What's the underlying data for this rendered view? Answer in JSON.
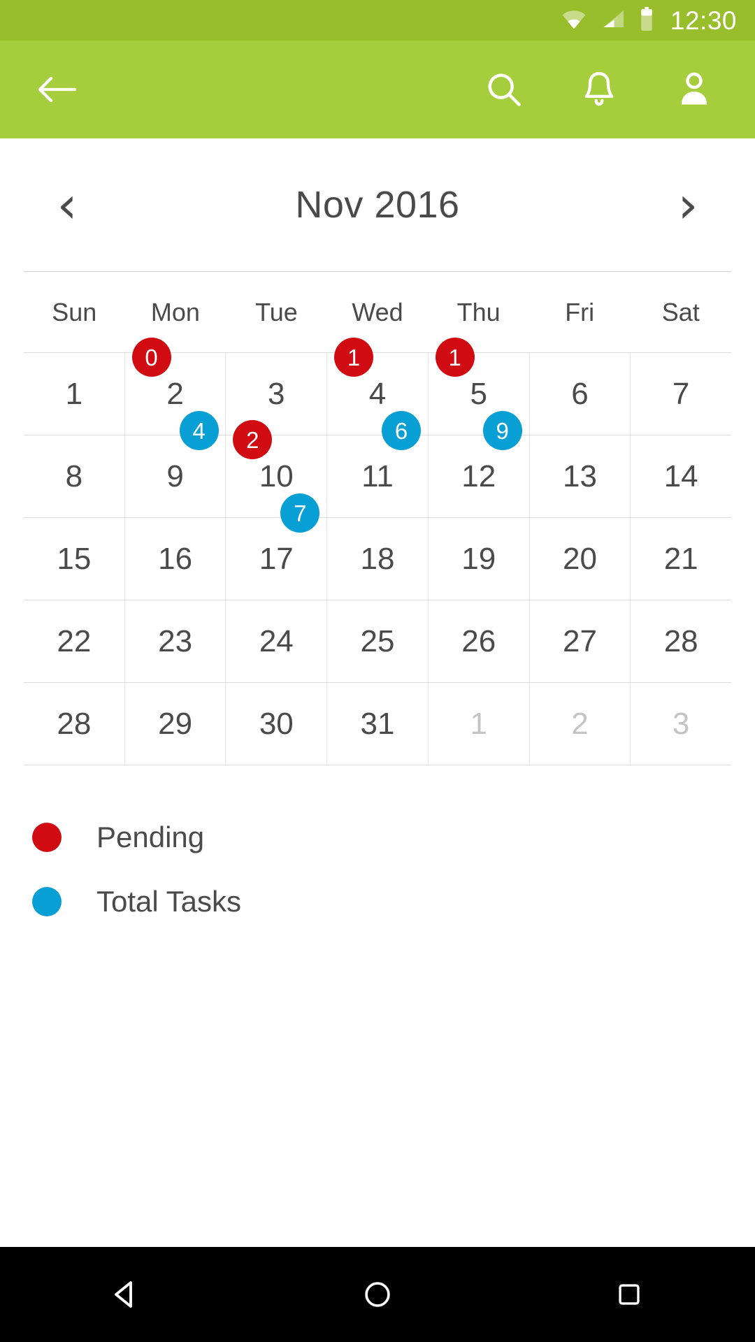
{
  "status_bar": {
    "time": "12:30",
    "icons": [
      "wifi-icon",
      "signal-icon",
      "battery-icon"
    ],
    "background": "#99be2c"
  },
  "app_bar": {
    "background": "#a6ce3c",
    "back_icon": "arrow-back-icon",
    "actions": [
      {
        "icon": "search-icon",
        "label": "Search"
      },
      {
        "icon": "bell-icon",
        "label": "Notifications"
      },
      {
        "icon": "person-icon",
        "label": "Profile"
      }
    ]
  },
  "month_header": {
    "prev_label": "‹",
    "next_label": "›",
    "title": "Nov 2016"
  },
  "weekdays": [
    "Sun",
    "Mon",
    "Tue",
    "Wed",
    "Thu",
    "Fri",
    "Sat"
  ],
  "legend": {
    "items": [
      {
        "label": "Pending",
        "color": "#d00b11"
      },
      {
        "label": "Total Tasks",
        "color": "#08a0d4"
      }
    ]
  },
  "nav_bar": {
    "back": "back-triangle-icon",
    "home": "home-circle-icon",
    "recents": "recents-square-icon"
  },
  "chart_data": {
    "type": "table",
    "title": "Nov 2016",
    "legend": [
      "Pending",
      "Total Tasks"
    ],
    "colors": {
      "pending": "#d00b11",
      "total": "#08a0d4"
    },
    "weeks": [
      [
        {
          "day": "1",
          "muted": false,
          "pending": null,
          "total": null
        },
        {
          "day": "2",
          "muted": false,
          "pending": "0",
          "total": "4"
        },
        {
          "day": "3",
          "muted": false,
          "pending": null,
          "total": null
        },
        {
          "day": "4",
          "muted": false,
          "pending": "1",
          "total": "6"
        },
        {
          "day": "5",
          "muted": false,
          "pending": "1",
          "total": "9"
        },
        {
          "day": "6",
          "muted": false,
          "pending": null,
          "total": null
        },
        {
          "day": "7",
          "muted": false,
          "pending": null,
          "total": null
        }
      ],
      [
        {
          "day": "8",
          "muted": false,
          "pending": null,
          "total": null
        },
        {
          "day": "9",
          "muted": false,
          "pending": null,
          "total": null
        },
        {
          "day": "10",
          "muted": false,
          "pending": "2",
          "total": "7"
        },
        {
          "day": "11",
          "muted": false,
          "pending": null,
          "total": null
        },
        {
          "day": "12",
          "muted": false,
          "pending": null,
          "total": null
        },
        {
          "day": "13",
          "muted": false,
          "pending": null,
          "total": null
        },
        {
          "day": "14",
          "muted": false,
          "pending": null,
          "total": null
        }
      ],
      [
        {
          "day": "15",
          "muted": false,
          "pending": null,
          "total": null
        },
        {
          "day": "16",
          "muted": false,
          "pending": null,
          "total": null
        },
        {
          "day": "17",
          "muted": false,
          "pending": null,
          "total": null
        },
        {
          "day": "18",
          "muted": false,
          "pending": null,
          "total": null
        },
        {
          "day": "19",
          "muted": false,
          "pending": null,
          "total": null
        },
        {
          "day": "20",
          "muted": false,
          "pending": null,
          "total": null
        },
        {
          "day": "21",
          "muted": false,
          "pending": null,
          "total": null
        }
      ],
      [
        {
          "day": "22",
          "muted": false,
          "pending": null,
          "total": null
        },
        {
          "day": "23",
          "muted": false,
          "pending": null,
          "total": null
        },
        {
          "day": "24",
          "muted": false,
          "pending": null,
          "total": null
        },
        {
          "day": "25",
          "muted": false,
          "pending": null,
          "total": null
        },
        {
          "day": "26",
          "muted": false,
          "pending": null,
          "total": null
        },
        {
          "day": "27",
          "muted": false,
          "pending": null,
          "total": null
        },
        {
          "day": "28",
          "muted": false,
          "pending": null,
          "total": null
        }
      ],
      [
        {
          "day": "28",
          "muted": false,
          "pending": null,
          "total": null
        },
        {
          "day": "29",
          "muted": false,
          "pending": null,
          "total": null
        },
        {
          "day": "30",
          "muted": false,
          "pending": null,
          "total": null
        },
        {
          "day": "31",
          "muted": false,
          "pending": null,
          "total": null
        },
        {
          "day": "1",
          "muted": true,
          "pending": null,
          "total": null
        },
        {
          "day": "2",
          "muted": true,
          "pending": null,
          "total": null
        },
        {
          "day": "3",
          "muted": true,
          "pending": null,
          "total": null
        }
      ]
    ]
  }
}
